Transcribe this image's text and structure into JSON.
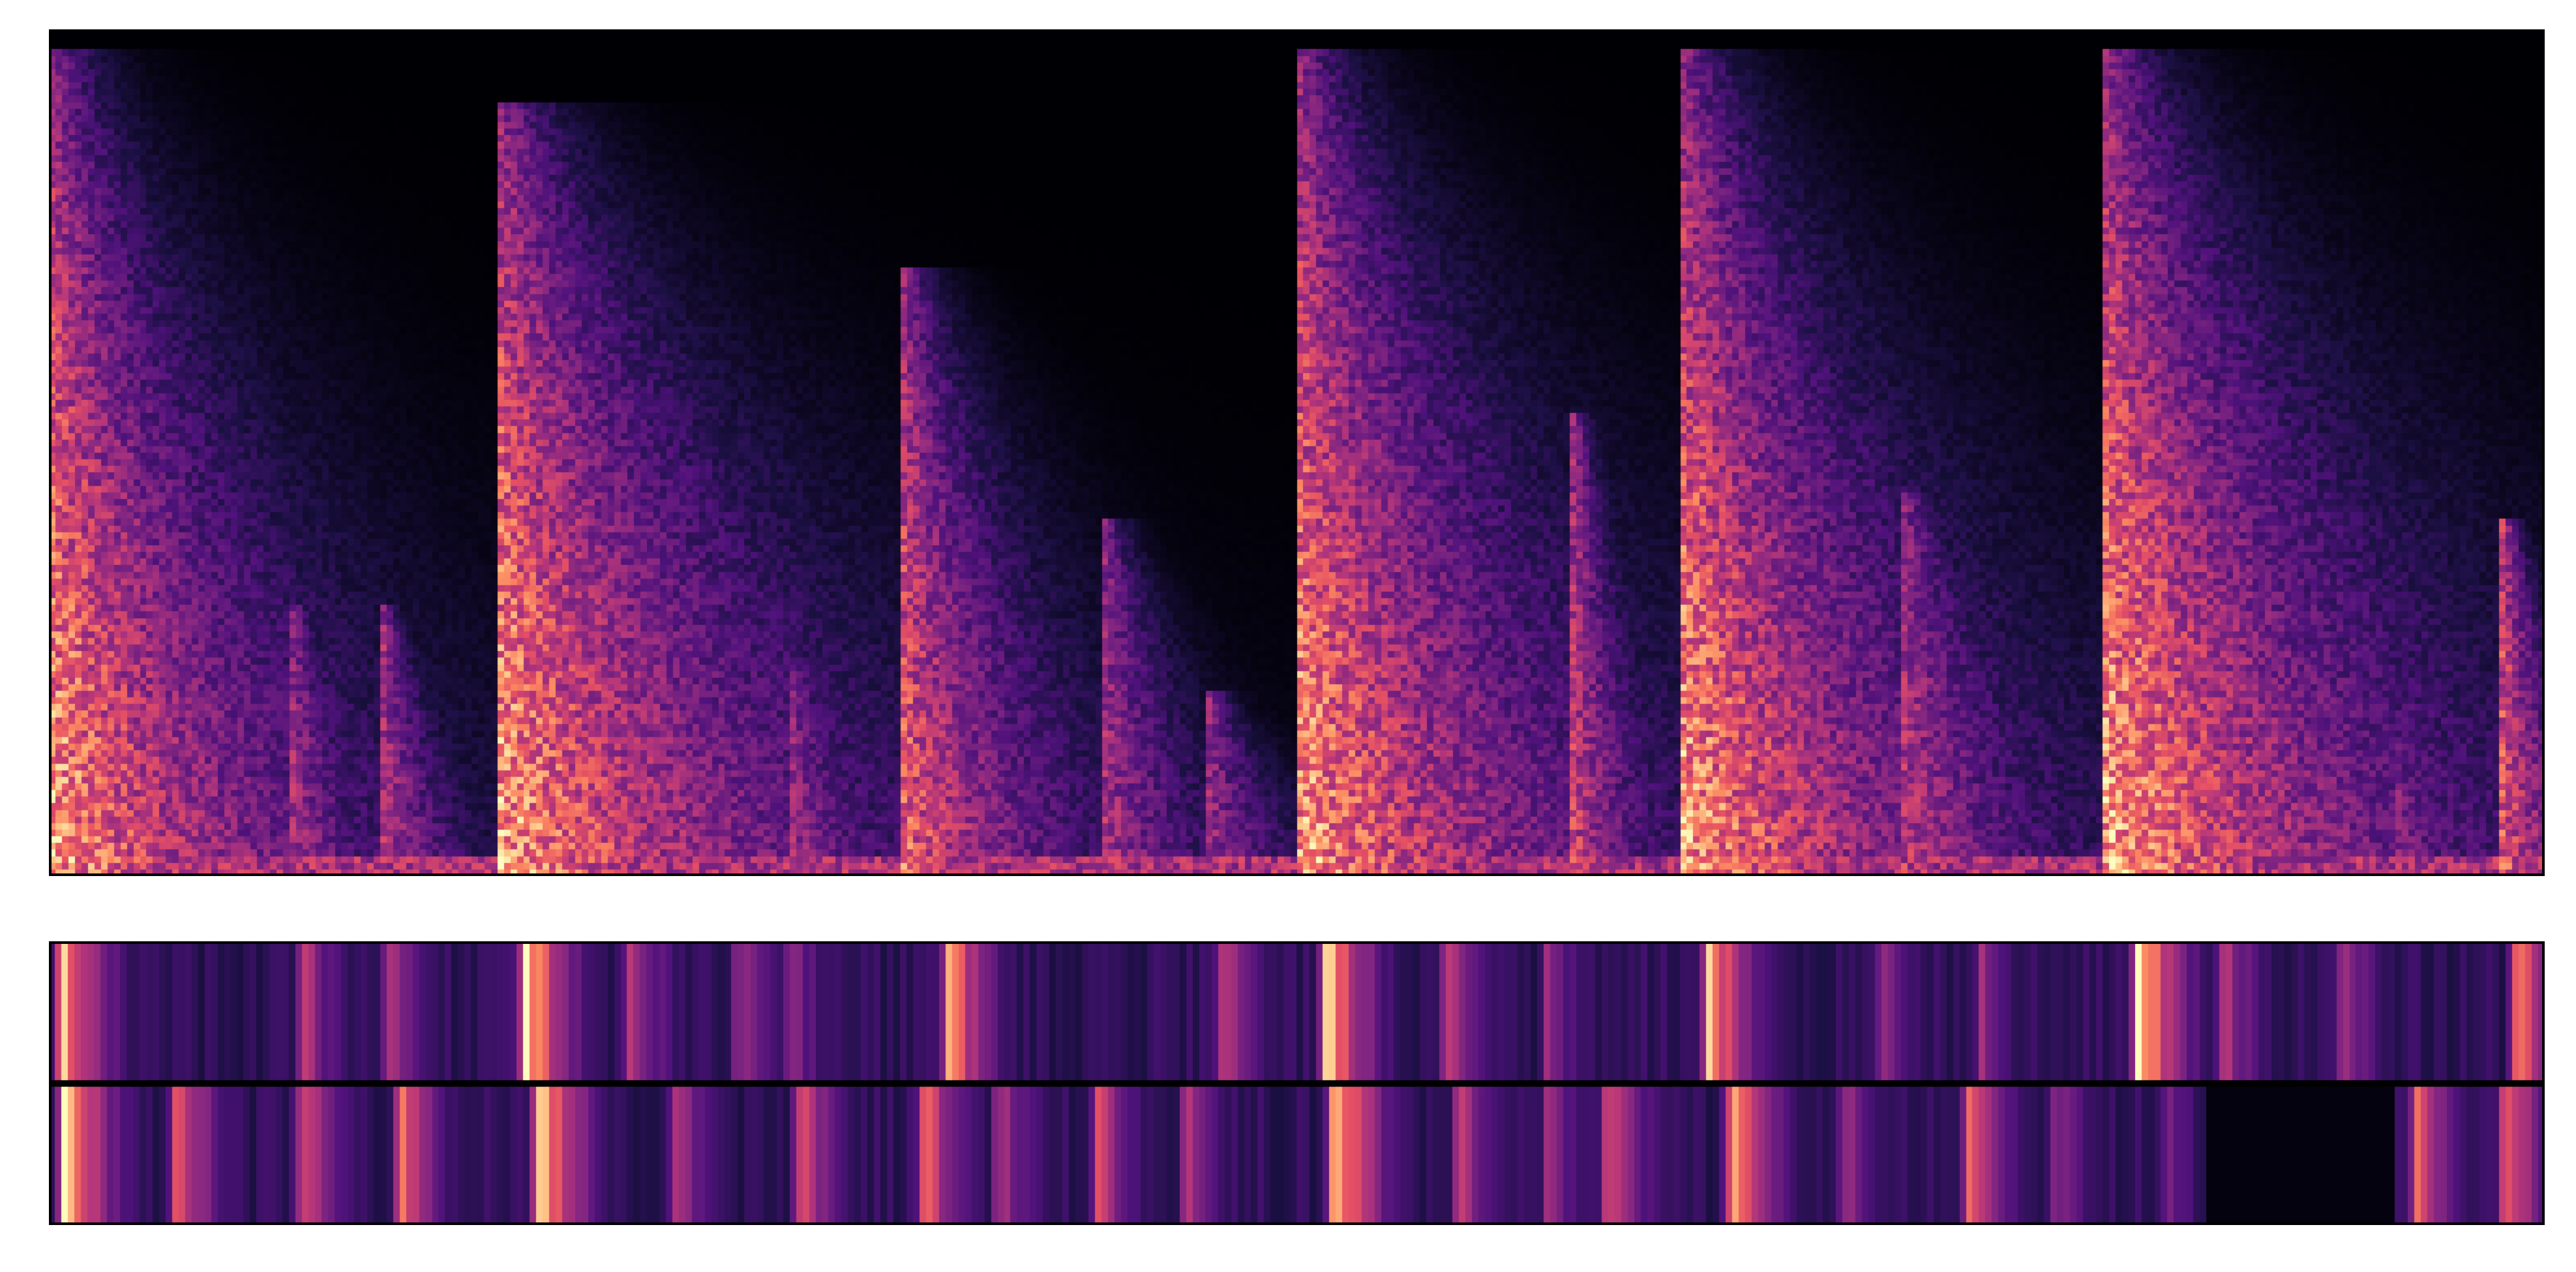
{
  "figure": {
    "background": "#ffffff",
    "frame_color": "#000000",
    "divider_color": "#000000"
  },
  "chart_data": [
    {
      "type": "heatmap",
      "panel": "spectrogram",
      "title": "",
      "xlabel": "",
      "ylabel": "",
      "colormap": "magma",
      "axes_visible": false,
      "grid": false,
      "legend": "none",
      "n_time_bins": 384,
      "n_freq_bins": 128,
      "onsets": [
        {
          "t": 0.0,
          "strength": 1.0,
          "decay": 0.09,
          "peak_freq": 0.98
        },
        {
          "t": 0.096,
          "strength": 0.55,
          "decay": 0.035,
          "peak_freq": 0.32
        },
        {
          "t": 0.133,
          "strength": 0.6,
          "decay": 0.03,
          "peak_freq": 0.32
        },
        {
          "t": 0.18,
          "strength": 1.0,
          "decay": 0.11,
          "peak_freq": 0.92
        },
        {
          "t": 0.298,
          "strength": 0.5,
          "decay": 0.04,
          "peak_freq": 0.25
        },
        {
          "t": 0.342,
          "strength": 0.8,
          "decay": 0.06,
          "peak_freq": 0.72
        },
        {
          "t": 0.424,
          "strength": 0.55,
          "decay": 0.04,
          "peak_freq": 0.42
        },
        {
          "t": 0.465,
          "strength": 0.5,
          "decay": 0.035,
          "peak_freq": 0.22
        },
        {
          "t": 0.501,
          "strength": 1.0,
          "decay": 0.1,
          "peak_freq": 0.98
        },
        {
          "t": 0.612,
          "strength": 0.65,
          "decay": 0.03,
          "peak_freq": 0.55
        },
        {
          "t": 0.655,
          "strength": 1.0,
          "decay": 0.1,
          "peak_freq": 0.98
        },
        {
          "t": 0.744,
          "strength": 0.6,
          "decay": 0.06,
          "peak_freq": 0.45
        },
        {
          "t": 0.826,
          "strength": 1.0,
          "decay": 0.11,
          "peak_freq": 0.98
        },
        {
          "t": 0.942,
          "strength": 0.45,
          "decay": 0.04,
          "peak_freq": 0.15
        },
        {
          "t": 0.985,
          "strength": 0.75,
          "decay": 0.03,
          "peak_freq": 0.42
        }
      ]
    },
    {
      "type": "heatmap",
      "panel": "activations",
      "title": "",
      "xlabel": "",
      "ylabel": "",
      "colormap": "magma",
      "axes_visible": false,
      "grid": false,
      "legend": "none",
      "rows": 2,
      "n_time_bins": 384,
      "row_peaks": [
        [
          {
            "t": 0.004,
            "v": 0.95
          },
          {
            "t": 0.1,
            "v": 0.55
          },
          {
            "t": 0.135,
            "v": 0.55
          },
          {
            "t": 0.19,
            "v": 1.0
          },
          {
            "t": 0.232,
            "v": 0.6
          },
          {
            "t": 0.275,
            "v": 0.5
          },
          {
            "t": 0.296,
            "v": 0.45
          },
          {
            "t": 0.36,
            "v": 0.85
          },
          {
            "t": 0.47,
            "v": 0.6
          },
          {
            "t": 0.512,
            "v": 0.95
          },
          {
            "t": 0.56,
            "v": 0.55
          },
          {
            "t": 0.6,
            "v": 0.45
          },
          {
            "t": 0.665,
            "v": 0.9
          },
          {
            "t": 0.735,
            "v": 0.45
          },
          {
            "t": 0.775,
            "v": 0.45
          },
          {
            "t": 0.838,
            "v": 1.0
          },
          {
            "t": 0.872,
            "v": 0.55
          },
          {
            "t": 0.92,
            "v": 0.5
          },
          {
            "t": 0.99,
            "v": 0.8
          }
        ],
        [
          {
            "t": 0.005,
            "v": 1.0
          },
          {
            "t": 0.05,
            "v": 0.75
          },
          {
            "t": 0.1,
            "v": 0.65
          },
          {
            "t": 0.14,
            "v": 0.7
          },
          {
            "t": 0.196,
            "v": 1.0
          },
          {
            "t": 0.25,
            "v": 0.55
          },
          {
            "t": 0.3,
            "v": 0.65
          },
          {
            "t": 0.35,
            "v": 0.7
          },
          {
            "t": 0.38,
            "v": 0.55
          },
          {
            "t": 0.42,
            "v": 0.6
          },
          {
            "t": 0.455,
            "v": 0.55
          },
          {
            "t": 0.515,
            "v": 1.0
          },
          {
            "t": 0.565,
            "v": 0.55
          },
          {
            "t": 0.6,
            "v": 0.45
          },
          {
            "t": 0.625,
            "v": 0.65
          },
          {
            "t": 0.675,
            "v": 0.95
          },
          {
            "t": 0.72,
            "v": 0.5
          },
          {
            "t": 0.77,
            "v": 0.75
          },
          {
            "t": 0.805,
            "v": 0.45
          },
          {
            "t": 0.85,
            "v": 0.4
          },
          {
            "t": 0.95,
            "v": 0.7
          },
          {
            "t": 0.985,
            "v": 0.75
          }
        ]
      ],
      "row_silence": [
        [],
        [
          {
            "start": 0.865,
            "end": 0.94
          }
        ]
      ]
    }
  ]
}
